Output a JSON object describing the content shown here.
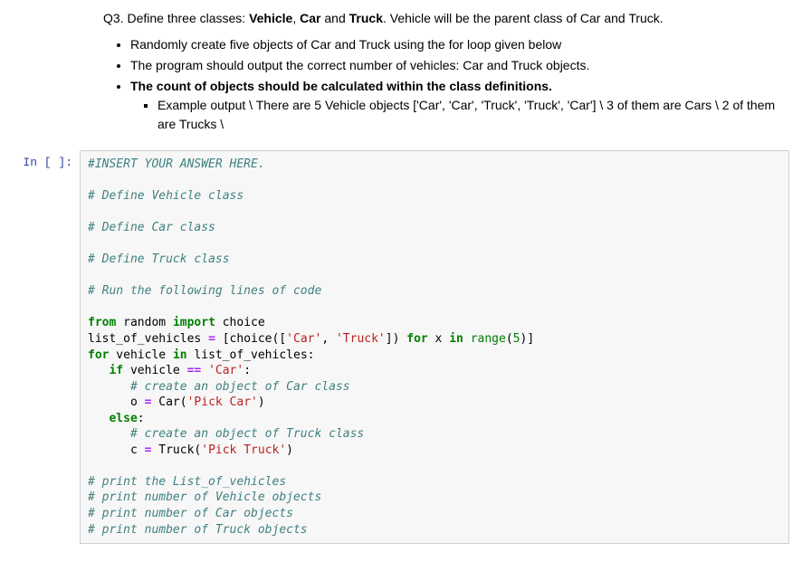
{
  "question": {
    "prefix": "Q3. Define three classes: ",
    "class1": "Vehicle",
    "comma1": ", ",
    "class2": "Car",
    "and": " and ",
    "class3": "Truck",
    "suffix": ". Vehicle will be the parent class of Car and Truck."
  },
  "bullets": {
    "b1": "Randomly create five objects of Car and Truck using the for loop given below",
    "b2": "The program should output the correct number of vehicles: Car and Truck objects.",
    "b3": "The count of objects should be calculated within the class definitions.",
    "sub1": "Example output \\ There are 5 Vehicle objects ['Car', 'Car', 'Truck', 'Truck', 'Car'] \\ 3 of them are Cars \\ 2 of them are Trucks \\"
  },
  "prompt": "In [ ]:",
  "code": {
    "l1": "#INSERT YOUR ANSWER HERE.",
    "l2": "",
    "l3": "# Define Vehicle class",
    "l4": "",
    "l5": "# Define Car class",
    "l6": "",
    "l7": "# Define Truck class",
    "l8": "",
    "l9": "# Run the following lines of code",
    "l10": "",
    "l11a": "from",
    "l11b": " random ",
    "l11c": "import",
    "l11d": " choice",
    "l12a": "list_of_vehicles ",
    "l12b": "=",
    "l12c": " [choice([",
    "l12d": "'Car'",
    "l12e": ", ",
    "l12f": "'Truck'",
    "l12g": "]) ",
    "l12h": "for",
    "l12i": " x ",
    "l12j": "in",
    "l12k": " ",
    "l12l": "range",
    "l12m": "(",
    "l12n": "5",
    "l12o": ")]",
    "l13a": "for",
    "l13b": " vehicle ",
    "l13c": "in",
    "l13d": " list_of_vehicles:",
    "l14a": "   ",
    "l14b": "if",
    "l14c": " vehicle ",
    "l14d": "==",
    "l14e": " ",
    "l14f": "'Car'",
    "l14g": ":",
    "l15a": "      ",
    "l15b": "# create an object of Car class",
    "l16a": "      o ",
    "l16b": "=",
    "l16c": " Car(",
    "l16d": "'Pick Car'",
    "l16e": ")",
    "l17a": "   ",
    "l17b": "else",
    "l17c": ":",
    "l18a": "      ",
    "l18b": "# create an object of Truck class",
    "l19a": "      c ",
    "l19b": "=",
    "l19c": " Truck(",
    "l19d": "'Pick Truck'",
    "l19e": ")",
    "l20": "",
    "l21": "# print the List_of_vehicles",
    "l22": "# print number of Vehicle objects",
    "l23": "# print number of Car objects",
    "l24": "# print number of Truck objects"
  }
}
